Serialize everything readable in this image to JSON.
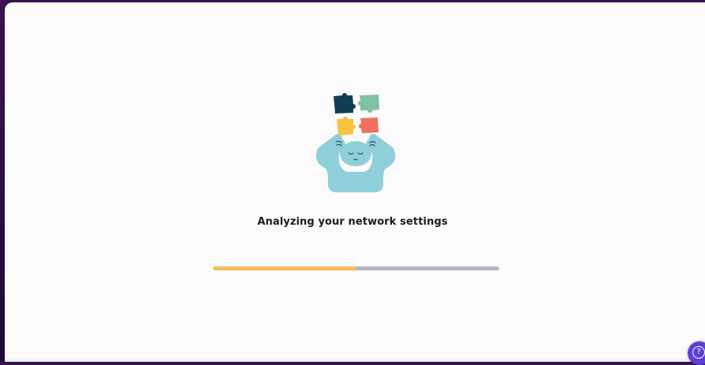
{
  "status": {
    "title": "Analyzing your network settings",
    "progress_fraction": 0.5
  },
  "illustration": {
    "name": "thinking-person-puzzle-icon"
  },
  "help": {
    "icon": "question-mark-icon",
    "glyph": "?"
  },
  "colors": {
    "progress_fill": "#f6bd5c",
    "progress_track": "#b5b3c3",
    "puzzle_navy": "#123c55",
    "puzzle_green": "#7fc1a0",
    "puzzle_yellow": "#f7c33f",
    "puzzle_coral": "#f0715d",
    "figure_blue": "#8fcfda",
    "help_button": "#5b3fd8"
  }
}
